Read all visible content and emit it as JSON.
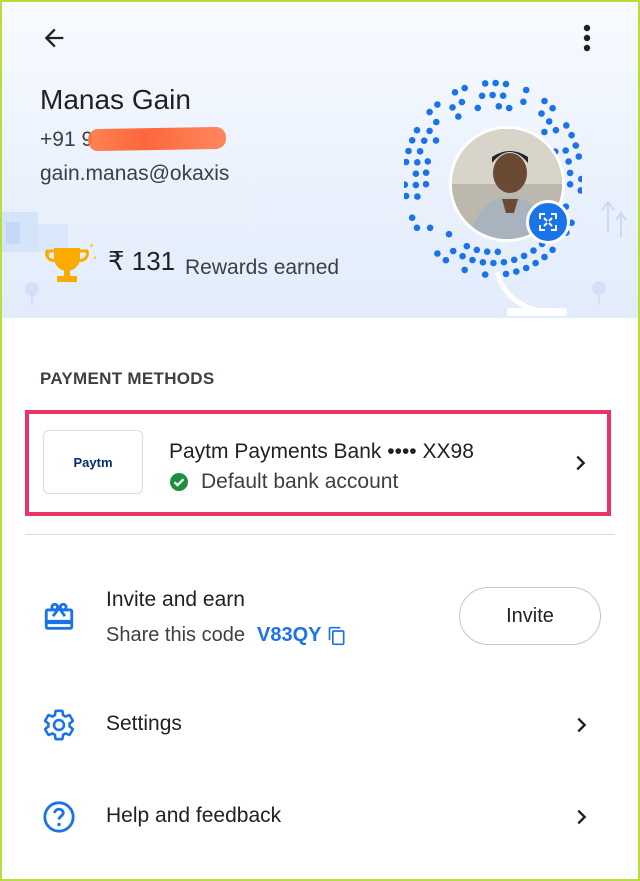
{
  "profile": {
    "name": "Manas Gain",
    "phone_prefix": "+91",
    "phone_visible_digits": "9",
    "email": "gain.manas@okaxis"
  },
  "rewards": {
    "amount": "₹ 131",
    "label": "Rewards earned"
  },
  "payment_methods": {
    "title": "PAYMENT METHODS",
    "bank": {
      "logo_text": "Paytm",
      "name": "Paytm Payments Bank •••• XX98",
      "status": "Default bank account"
    }
  },
  "invite": {
    "title": "Invite and earn",
    "subtitle": "Share this code",
    "code": "V83QY",
    "button_label": "Invite"
  },
  "settings": {
    "label": "Settings"
  },
  "help": {
    "label": "Help and feedback"
  },
  "icons": {
    "back": "arrow-back-icon",
    "menu": "more-vert-icon",
    "trophy": "trophy-icon",
    "expand": "expand-icon",
    "check": "check-circle-icon",
    "gift": "gift-icon",
    "gear": "gear-icon",
    "help": "help-icon",
    "chevron": "chevron-right-icon",
    "copy": "copy-icon"
  },
  "colors": {
    "accent": "#1a73e8",
    "highlight_border": "#ea3467",
    "success": "#1e8e3e",
    "trophy": "#f9ab00",
    "frame_border": "#b5e03a"
  }
}
